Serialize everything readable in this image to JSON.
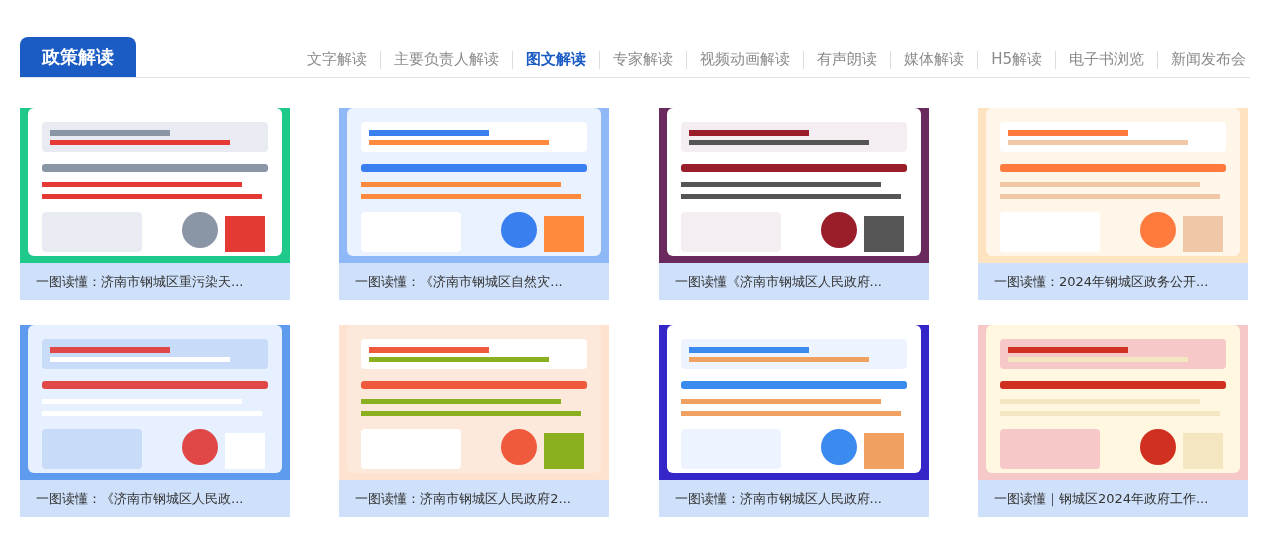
{
  "section_title": "政策解读",
  "tabs": [
    {
      "label": "文字解读",
      "selected": false
    },
    {
      "label": "主要负责人解读",
      "selected": false
    },
    {
      "label": "图文解读",
      "selected": true
    },
    {
      "label": "专家解读",
      "selected": false
    },
    {
      "label": "视频动画解读",
      "selected": false
    },
    {
      "label": "有声朗读",
      "selected": false
    },
    {
      "label": "媒体解读",
      "selected": false
    },
    {
      "label": "H5解读",
      "selected": false
    },
    {
      "label": "电子书浏览",
      "selected": false
    },
    {
      "label": "新闻发布会",
      "selected": false
    }
  ],
  "cards": [
    {
      "caption": "一图读懂：济南市钢城区重污染天..."
    },
    {
      "caption": "一图读懂：《济南市钢城区自然灾..."
    },
    {
      "caption": "一图读懂《济南市钢城区人民政府..."
    },
    {
      "caption": "一图读懂：2024年钢城区政务公开..."
    },
    {
      "caption": "一图读懂：《济南市钢城区人民政..."
    },
    {
      "caption": "一图读懂：济南市钢城区人民政府2..."
    },
    {
      "caption": "一图读懂：济南市钢城区人民政府..."
    },
    {
      "caption": "一图读懂｜钢城区2024年政府工作..."
    }
  ]
}
